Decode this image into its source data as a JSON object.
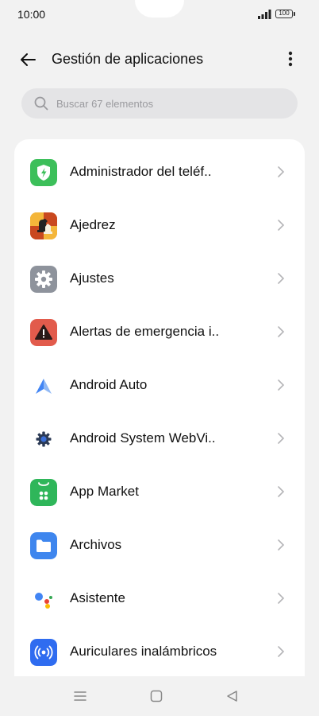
{
  "status_bar": {
    "time": "10:00",
    "battery": "100"
  },
  "header": {
    "title": "Gestión de aplicaciones",
    "back_icon": "arrow-left-icon",
    "more_icon": "more-vertical-icon"
  },
  "search": {
    "placeholder": "Buscar 67 elementos",
    "value": "",
    "icon": "search-icon"
  },
  "apps": [
    {
      "label": "Administrador del teléf..",
      "icon": "phone-manager-icon",
      "color": "#3cbf5a"
    },
    {
      "label": "Ajedrez",
      "icon": "chess-icon",
      "color": "#e8902a"
    },
    {
      "label": "Ajustes",
      "icon": "settings-gear-icon",
      "color": "#8e939c"
    },
    {
      "label": "Alertas de emergencia i..",
      "icon": "emergency-alert-icon",
      "color": "#e25b4c"
    },
    {
      "label": "Android Auto",
      "icon": "android-auto-icon",
      "color": "#4285f4"
    },
    {
      "label": "Android System WebVi..",
      "icon": "webview-gear-icon",
      "color": "#3a6fd8"
    },
    {
      "label": "App Market",
      "icon": "app-market-icon",
      "color": "#2fb65a"
    },
    {
      "label": "Archivos",
      "icon": "folder-icon",
      "color": "#3e86ee"
    },
    {
      "label": "Asistente",
      "icon": "assistant-icon",
      "color": "#4285f4"
    },
    {
      "label": "Auriculares inalámbricos",
      "icon": "wireless-earbuds-icon",
      "color": "#2f6cf0"
    }
  ],
  "nav": {
    "menu_icon": "menu-icon",
    "home_icon": "home-square-icon",
    "back_icon": "back-triangle-icon"
  }
}
